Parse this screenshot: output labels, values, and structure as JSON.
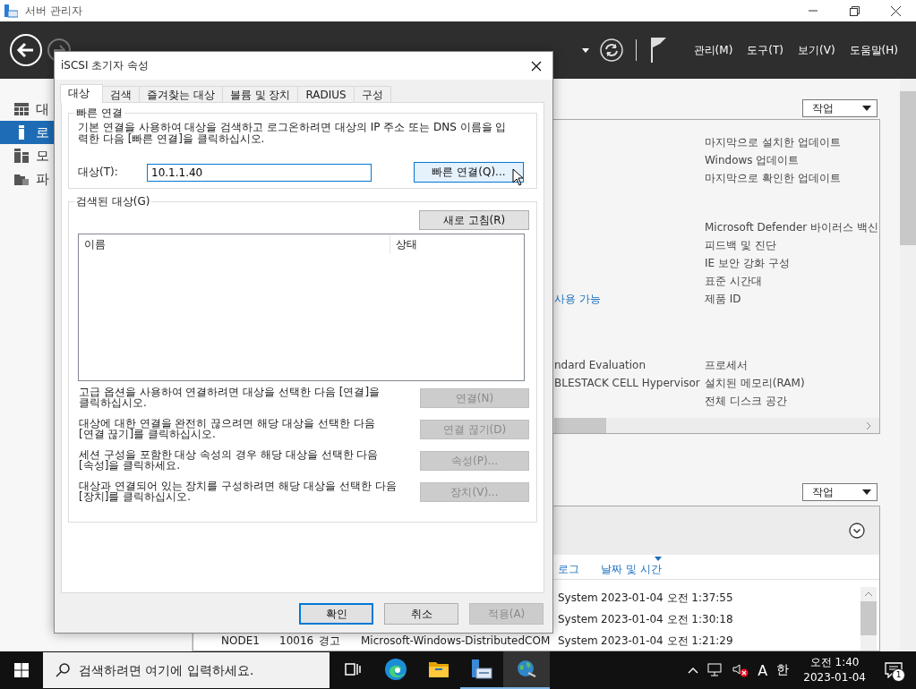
{
  "window": {
    "title": "서버 관리자"
  },
  "header": {
    "menus": [
      "관리(M)",
      "도구(T)",
      "보기(V)",
      "도움말(H)"
    ]
  },
  "sidebar": {
    "items": [
      {
        "kind": "dashboard",
        "label": "대",
        "selected": false
      },
      {
        "kind": "server",
        "label": "로",
        "selected": true
      },
      {
        "kind": "servers",
        "label": "모",
        "selected": false
      },
      {
        "kind": "files",
        "label": "파",
        "selected": false
      }
    ]
  },
  "properties": {
    "tasks_button": "작업",
    "groups": [
      [
        {
          "label": "마지막으로 설치한 업데이트"
        },
        {
          "label": "Windows 업데이트"
        },
        {
          "label": "마지막으로 확인한 업데이트"
        }
      ],
      [
        {
          "label": "Microsoft Defender 바이러스 백신"
        },
        {
          "label": "피드백 및 진단"
        },
        {
          "label": "IE 보안 강화 구성"
        },
        {
          "label": "표준 시간대"
        },
        {
          "value": {
            "text": "사용 가능",
            "link": true
          },
          "label": "제품 ID"
        }
      ],
      [
        {
          "value": {
            "text": "ndard Evaluation",
            "link": false
          },
          "label": "프로세서"
        },
        {
          "value": {
            "text": "BLESTACK CELL Hypervisor",
            "link": false
          },
          "label": "설치된 메모리(RAM)"
        },
        {
          "label": "전체 디스크 공간"
        }
      ]
    ]
  },
  "events": {
    "tasks_button": "작업",
    "columns": [
      {
        "label": "로그",
        "sorted": false
      },
      {
        "label": "날짜 및 시간",
        "sorted": true
      }
    ],
    "rows": [
      {
        "log": "System",
        "date_time": "2023-01-04 오전 1:37:55"
      },
      {
        "log": "System",
        "date_time": "2023-01-04 오전 1:30:18"
      },
      {
        "column_1": "NODE1",
        "column_2": "10016",
        "column_3": "경고",
        "column_4": "Microsoft-Windows-DistributedCOM",
        "log": "System",
        "date_time": "2023-01-04 오전 1:21:29"
      }
    ]
  },
  "dialog": {
    "title": "iSCSI 초기자 속성",
    "tabs": [
      {
        "label": "대상",
        "selected": true
      },
      {
        "label": "검색",
        "selected": false
      },
      {
        "label": "즐겨찾는 대상",
        "selected": false
      },
      {
        "label": "볼륨 및 장치",
        "selected": false
      },
      {
        "label": "RADIUS",
        "selected": false
      },
      {
        "label": "구성",
        "selected": false
      }
    ],
    "quick_connect": {
      "legend": "빠른 연결",
      "description": "기본 연결을 사용하여 대상을 검색하고 로그온하려면 대상의 IP 주소 또는 DNS 이름을 입력한 다음 [빠른 연결]을 클릭하십시오.",
      "target_label": "대상(T):",
      "target_value": "10.1.1.40",
      "button": {
        "label": "빠른 연결(Q)...",
        "hovered": true
      }
    },
    "discovered": {
      "legend": "검색된 대상(G)",
      "refresh_button": "새로 고침(R)",
      "columns": [
        "이름",
        "상태"
      ],
      "actions": [
        {
          "text": "고급 옵션을 사용하여 연결하려면 대상을 선택한 다음 [연결]을 클릭하십시오.",
          "button": "연결(N)",
          "disabled": true
        },
        {
          "text": "대상에 대한 연결을 완전히 끊으려면 해당 대상을 선택한 다음 [연결 끊기]를 클릭하십시오.",
          "button": "연결 끊기(D)",
          "disabled": true
        },
        {
          "text": "세션 구성을 포함한 대상 속성의 경우 해당 대상을 선택한 다음 [속성]을 클릭하세요.",
          "button": "속성(P)...",
          "disabled": true
        },
        {
          "text": "대상과 연결되어 있는 장치를 구성하려면 해당 대상을 선택한 다음 [장치]를 클릭하십시오.",
          "button": "장치(V)...",
          "disabled": true
        }
      ]
    },
    "buttons": [
      {
        "label": "확인",
        "default": true,
        "disabled": false
      },
      {
        "label": "취소",
        "default": false,
        "disabled": false
      },
      {
        "label": "적용(A)",
        "default": false,
        "disabled": true
      }
    ]
  },
  "taskbar": {
    "search_placeholder": "검색하려면 여기에 입력하세요.",
    "apps": [
      {
        "kind": "task-view",
        "running": false,
        "selected": false
      },
      {
        "kind": "browser",
        "running": false,
        "selected": false
      },
      {
        "kind": "folder",
        "running": false,
        "selected": false
      },
      {
        "kind": "server-manager",
        "running": true,
        "selected": false
      },
      {
        "kind": "network",
        "running": true,
        "selected": true
      }
    ],
    "tray": {
      "muted": true,
      "ime_mode": "A",
      "ime_lang": "한",
      "time": "오전 1:40",
      "date": "2023-01-04",
      "notifications": "1"
    }
  }
}
